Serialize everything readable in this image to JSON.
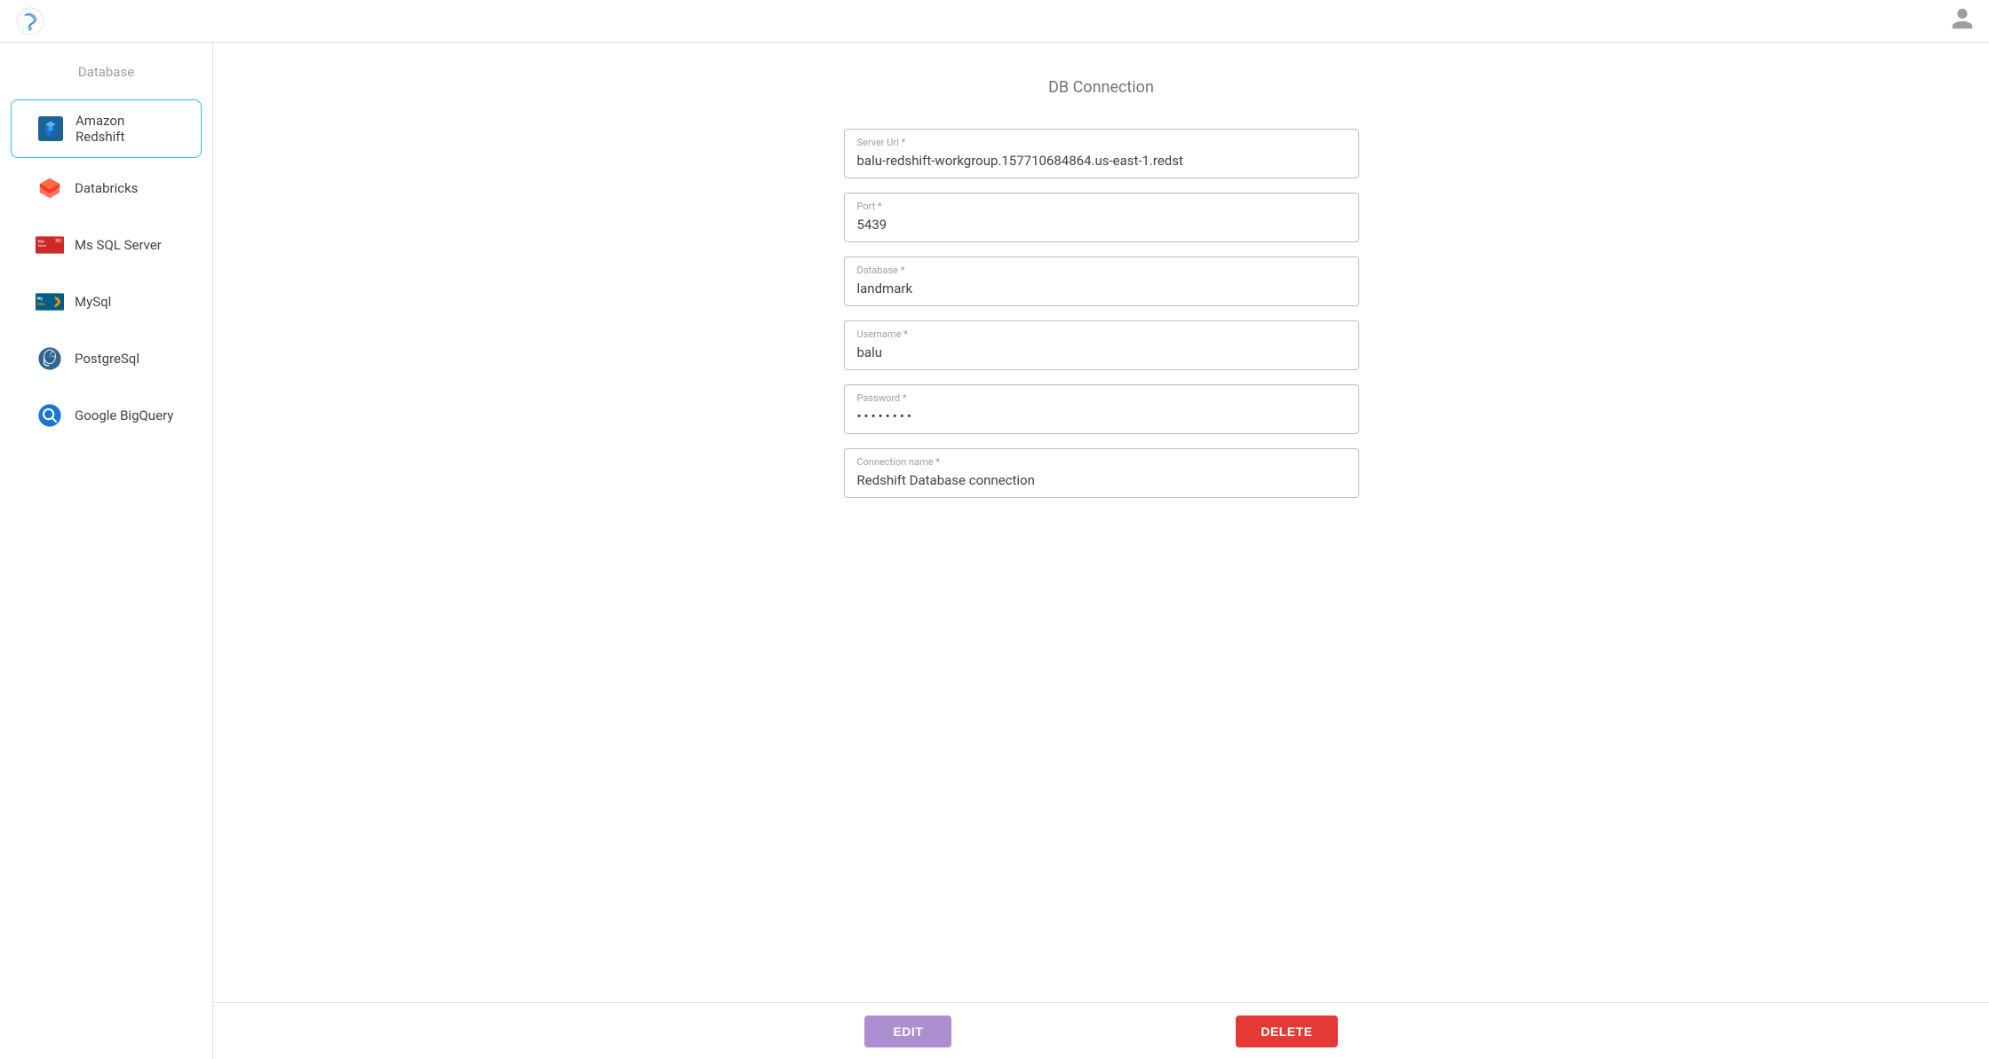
{
  "navbar": {
    "logo_alt": "App Logo"
  },
  "sidebar": {
    "title": "Database",
    "items": [
      {
        "id": "amazon-redshift",
        "label": "Amazon Redshift",
        "active": true
      },
      {
        "id": "databricks",
        "label": "Databricks",
        "active": false
      },
      {
        "id": "ms-sql-server",
        "label": "Ms SQL Server",
        "active": false
      },
      {
        "id": "mysql",
        "label": "MySql",
        "active": false
      },
      {
        "id": "postgresql",
        "label": "PostgreSql",
        "active": false
      },
      {
        "id": "google-bigquery",
        "label": "Google BigQuery",
        "active": false
      }
    ]
  },
  "main": {
    "title": "DB Connection",
    "form": {
      "server_url_label": "Server Url *",
      "server_url_value": "balu-redshift-workgroup.157710684864.us-east-1.redst",
      "port_label": "Port *",
      "port_value": "5439",
      "database_label": "Database *",
      "database_value": "landmark",
      "username_label": "Username *",
      "username_value": "balu",
      "password_label": "Password *",
      "password_value": "•••••••",
      "connection_name_label": "Connection name *",
      "connection_name_value": "Redshift Database connection"
    }
  },
  "actions": {
    "edit_label": "EDIT",
    "delete_label": "DELETE"
  }
}
